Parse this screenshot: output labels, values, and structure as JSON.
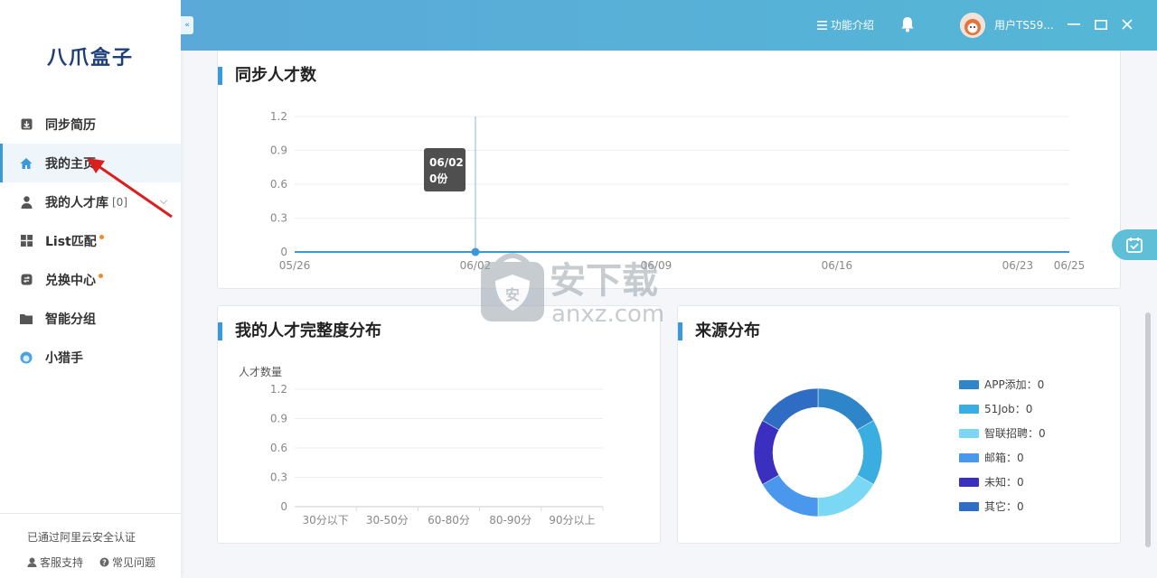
{
  "app": {
    "logo": "八爪盒子"
  },
  "sidebar": {
    "items": [
      {
        "label": "同步简历",
        "icon": "download-box-icon"
      },
      {
        "label": "我的主页",
        "icon": "home-icon",
        "active": true
      },
      {
        "label": "我的人才库",
        "icon": "person-icon",
        "count": "[0]"
      },
      {
        "label": "List匹配",
        "icon": "grid-icon",
        "dot": true
      },
      {
        "label": "兑换中心",
        "icon": "exchange-icon",
        "dot": true
      },
      {
        "label": "智能分组",
        "icon": "folder-icon"
      },
      {
        "label": "小猎手",
        "icon": "hunter-icon"
      }
    ],
    "certification": "已通过阿里云安全认证",
    "support_label": "客服支持",
    "faq_label": "常见问题"
  },
  "header": {
    "feature_label": "功能介绍",
    "username": "用户TS59..."
  },
  "colors": {
    "accent": "#3a9ad9",
    "header_start": "#5aa9d8",
    "header_end": "#55b7d6",
    "notice_dot": "#f08a24"
  },
  "sync_card": {
    "title": "同步人才数",
    "tooltip": {
      "date": "06/02",
      "value": "0份"
    }
  },
  "completeness_card": {
    "title": "我的人才完整度分布"
  },
  "source_card": {
    "title": "来源分布",
    "legend": [
      {
        "label": "APP添加：0",
        "color": "#2e86c8"
      },
      {
        "label": "51Job：0",
        "color": "#3aaee0"
      },
      {
        "label": "智联招聘：0",
        "color": "#7ad8f5"
      },
      {
        "label": "邮箱：0",
        "color": "#4a98ee"
      },
      {
        "label": "未知：0",
        "color": "#3b2fc0"
      },
      {
        "label": "其它：0",
        "color": "#2f6cc4"
      }
    ]
  },
  "watermark": {
    "text": "安下载",
    "subtext": "anxz.com"
  },
  "chart_data": [
    {
      "type": "line",
      "title": "同步人才数",
      "x": [
        "05/26",
        "06/02",
        "06/09",
        "06/16",
        "06/23",
        "06/25"
      ],
      "yticks": [
        "0",
        "0.3",
        "0.6",
        "0.9",
        "1.2"
      ],
      "ylim": [
        0,
        1.2
      ],
      "series": [
        {
          "values": [
            0,
            0,
            0,
            0,
            0,
            0
          ],
          "color": "#3a9ad9"
        }
      ],
      "highlight": "06/02"
    },
    {
      "type": "bar",
      "title": "我的人才完整度分布",
      "ylabel": "人才数量",
      "categories": [
        "30分以下",
        "30-50分",
        "60-80分",
        "80-90分",
        "90分以上"
      ],
      "values": [
        0,
        0,
        0,
        0,
        0
      ],
      "yticks": [
        "0",
        "0.3",
        "0.6",
        "0.9",
        "1.2"
      ],
      "ylim": [
        0,
        1.2
      ]
    },
    {
      "type": "pie",
      "title": "来源分布",
      "categories": [
        "APP添加",
        "51Job",
        "智联招聘",
        "邮箱",
        "未知",
        "其它"
      ],
      "values": [
        0,
        0,
        0,
        0,
        0,
        0
      ],
      "colors": [
        "#2e86c8",
        "#3aaee0",
        "#7ad8f5",
        "#4a98ee",
        "#3b2fc0",
        "#2f6cc4"
      ]
    }
  ]
}
